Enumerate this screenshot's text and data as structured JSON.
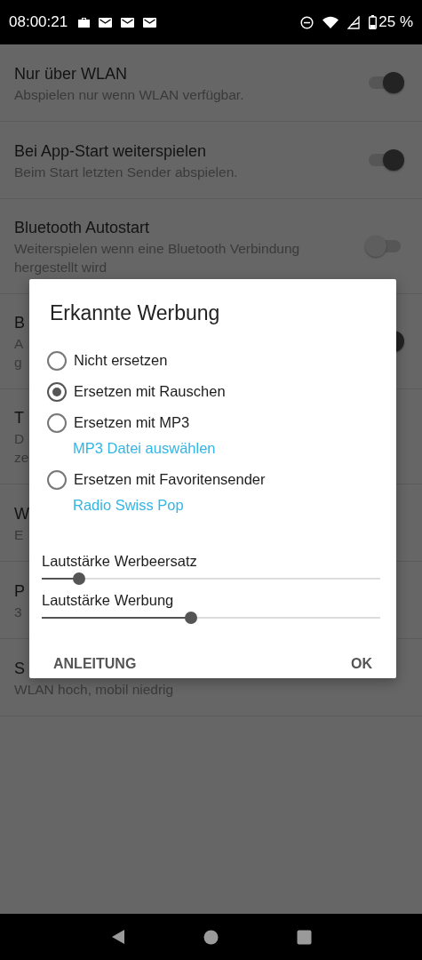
{
  "status_bar": {
    "time": "08:00:21",
    "battery": "25 %"
  },
  "settings": [
    {
      "title": "Nur über WLAN",
      "summary_lines": [
        "Abspielen nur wenn WLAN verfügbar."
      ],
      "kind": "toggle",
      "on": true
    },
    {
      "title": "Bei App-Start weiterspielen",
      "summary_lines": [
        "Beim Start letzten Sender abspielen."
      ],
      "kind": "toggle",
      "on": true
    },
    {
      "title": "Bluetooth Autostart",
      "summary_lines": [
        "Weiterspielen wenn eine Bluetooth Verbindung",
        "hergestellt wird"
      ],
      "kind": "toggle",
      "on": false
    },
    {
      "title": "B",
      "summary_lines": [
        "A",
        "g"
      ],
      "kind": "toggle",
      "on": true
    },
    {
      "title": "T",
      "summary_lines": [
        "D",
        "ze"
      ],
      "kind": "plain"
    },
    {
      "title": "W",
      "summary_lines": [
        "E"
      ],
      "kind": "plain"
    },
    {
      "title": "P",
      "summary_lines": [
        "3"
      ],
      "kind": "plain"
    },
    {
      "title": "S",
      "summary_lines": [
        "WLAN hoch, mobil niedrig"
      ],
      "kind": "plain"
    }
  ],
  "dialog": {
    "title": "Erkannte Werbung",
    "options": [
      {
        "label": "Nicht ersetzen",
        "selected": false
      },
      {
        "label": "Ersetzen mit Rauschen",
        "selected": true
      },
      {
        "label": "Ersetzen mit MP3",
        "selected": false,
        "link": "MP3 Datei auswählen"
      },
      {
        "label": "Ersetzen mit Favoritensender",
        "selected": false,
        "link": "Radio Swiss Pop"
      }
    ],
    "sliders": [
      {
        "label": "Lautstärke Werbeersatz",
        "level": 0.11
      },
      {
        "label": "Lautstärke Werbung",
        "level": 0.44
      }
    ],
    "buttons": [
      "ANLEITUNG",
      "OK"
    ]
  }
}
